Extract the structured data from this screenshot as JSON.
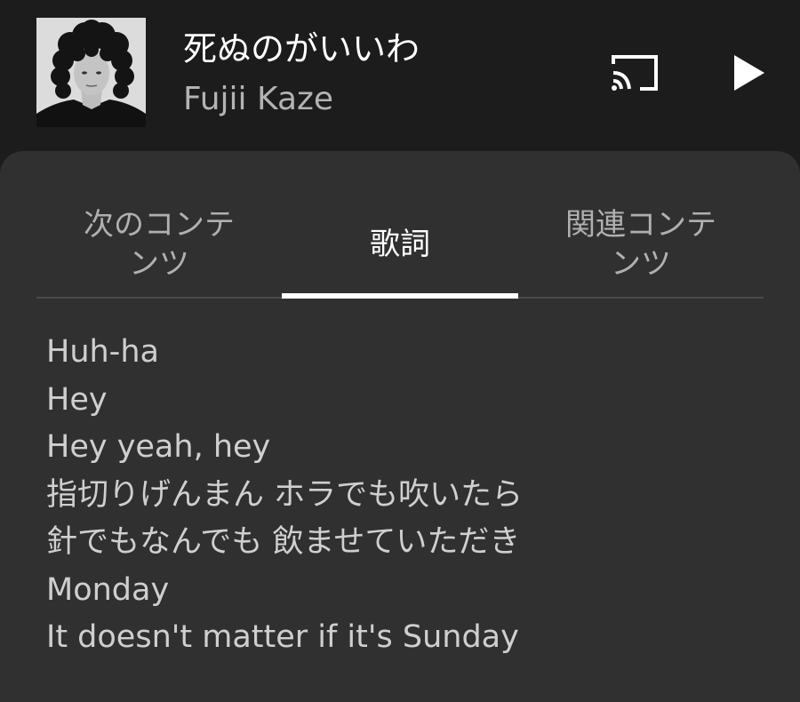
{
  "header": {
    "song_title": "死ぬのがいいわ",
    "artist": "Fujii Kaze",
    "album_art_icon": "artist-portrait",
    "cast_icon": "cast-icon",
    "play_icon": "play-icon"
  },
  "tabs": [
    {
      "label": "次のコンテンツ",
      "line1": "次のコンテ",
      "line2": "ンツ"
    },
    {
      "label": "歌詞"
    },
    {
      "label": "関連コンテンツ",
      "line1": "関連コンテ",
      "line2": "ンツ"
    }
  ],
  "active_tab_index": 1,
  "lyrics": [
    "Huh-ha",
    "Hey",
    "Hey yeah, hey",
    "指切りげんまん ホラでも吹いたら",
    "針でもなんでも 飲ませていただき",
    "Monday",
    "It doesn't matter if it's Sunday"
  ],
  "colors": {
    "background": "#1c1c1c",
    "sheet": "#303030",
    "active_text": "#ffffff",
    "inactive_text": "#b0b0b0",
    "lyric_text": "#cfcfcf"
  }
}
